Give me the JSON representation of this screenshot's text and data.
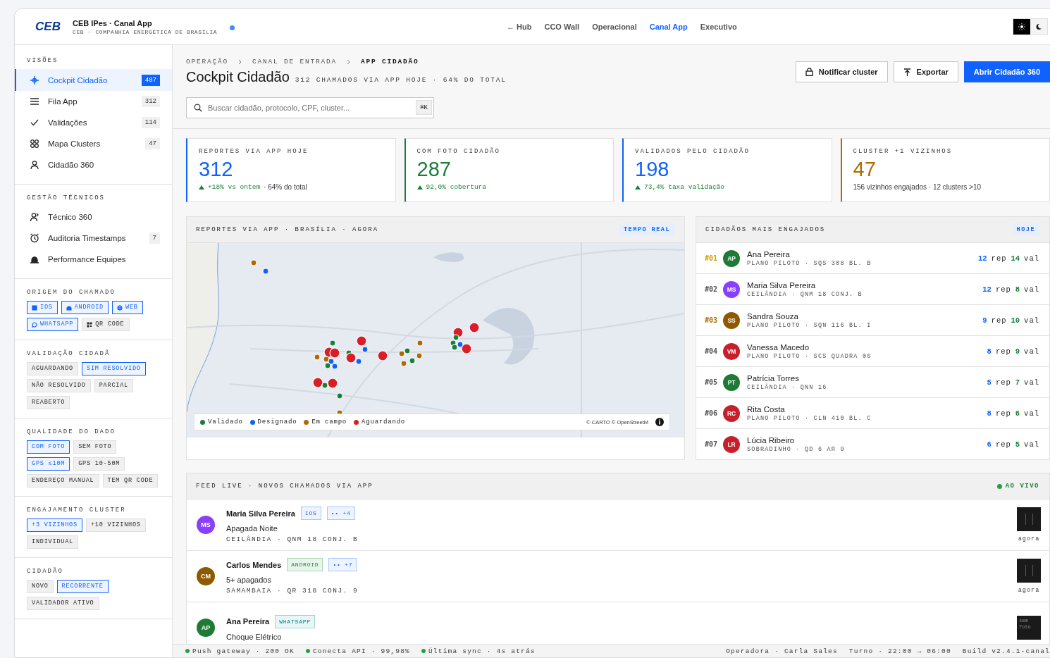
{
  "header": {
    "logo": "CEB",
    "title": "CEB IPes · Canal App",
    "subtitle": "CEB · COMPANHIA ENERGÉTICA DE BRASÍLIA",
    "nav": [
      {
        "label": "← Hub",
        "selected": false
      },
      {
        "label": "CCO Wall",
        "selected": false
      },
      {
        "label": "Operacional",
        "selected": false
      },
      {
        "label": "Canal App",
        "selected": true
      },
      {
        "label": "Executivo",
        "selected": false
      }
    ],
    "theme": [
      {
        "kind": "light",
        "selected": true
      },
      {
        "kind": "dark",
        "selected": false
      }
    ]
  },
  "sidebar": {
    "nav_sections": [
      {
        "title": "VISÕES",
        "items": [
          {
            "label": "Cockpit Cidadão",
            "count": "487",
            "selected": true
          },
          {
            "label": "Fila App",
            "count": "312",
            "selected": false
          },
          {
            "label": "Validações",
            "count": "114",
            "selected": false
          },
          {
            "label": "Mapa Clusters",
            "count": "47",
            "selected": false
          },
          {
            "label": "Cidadão 360",
            "selected": false
          }
        ]
      },
      {
        "title": "GESTÃO TÉCNICOS",
        "items": [
          {
            "label": "Técnico 360",
            "selected": false
          },
          {
            "label": "Auditoria Timestamps",
            "count": "7",
            "selected": false
          },
          {
            "label": "Performance Equipes",
            "selected": false
          }
        ]
      }
    ],
    "filter_groups": [
      {
        "title": "ORIGEM DO CHAMADO",
        "chips": [
          {
            "label": "IOS",
            "selected": true
          },
          {
            "label": "ANDROID",
            "selected": true
          },
          {
            "label": "WEB",
            "selected": true
          },
          {
            "label": "WHATSAPP",
            "selected": true
          },
          {
            "label": "QR CODE",
            "selected": false
          }
        ]
      },
      {
        "title": "VALIDAÇÃO CIDADÃ",
        "chips": [
          {
            "label": "AGUARDANDO",
            "selected": false
          },
          {
            "label": "SIM RESOLVIDO",
            "selected": true
          },
          {
            "label": "NÃO RESOLVIDO",
            "selected": false
          },
          {
            "label": "PARCIAL",
            "selected": false
          },
          {
            "label": "REABERTO",
            "selected": false
          }
        ]
      },
      {
        "title": "QUALIDADE DO DADO",
        "chips": [
          {
            "label": "COM FOTO",
            "selected": true
          },
          {
            "label": "SEM FOTO",
            "selected": false
          },
          {
            "label": "GPS ≤10M",
            "selected": true
          },
          {
            "label": "GPS 10-50M",
            "selected": false
          },
          {
            "label": "ENDEREÇO MANUAL",
            "selected": false
          },
          {
            "label": "TEM QR CODE",
            "selected": false
          }
        ]
      },
      {
        "title": "ENGAJAMENTO CLUSTER",
        "chips": [
          {
            "label": "+3 VIZINHOS",
            "selected": true
          },
          {
            "label": "+10 VIZINHOS",
            "selected": false
          },
          {
            "label": "INDIVIDUAL",
            "selected": false
          }
        ]
      },
      {
        "title": "CIDADÃO",
        "chips": [
          {
            "label": "NOVO",
            "selected": false
          },
          {
            "label": "RECORRENTE",
            "selected": true
          },
          {
            "label": "VALIDADOR ATIVO",
            "selected": false
          }
        ]
      }
    ]
  },
  "breadcrumb": [
    "OPERAÇÃO",
    "CANAL DE ENTRADA",
    "APP CIDADÃO"
  ],
  "page_title": "Cockpit Cidadão",
  "page_subtitle": "312 CHAMADOS VIA APP HOJE · 64% DO TOTAL",
  "actions": [
    {
      "label": "Notificar cluster",
      "kind": "lock"
    },
    {
      "label": "Exportar",
      "kind": "export"
    },
    {
      "label": "Abrir Cidadão 360",
      "kind": "primary"
    }
  ],
  "search": {
    "placeholder": "Buscar cidadão, protocolo, CPF, cluster...",
    "shortcut": "⌘K"
  },
  "kpis": [
    {
      "label": "REPORTES VIA APP HOJE",
      "value": "312",
      "color": "#0f62fe",
      "delta": "+18% vs ontem",
      "note": "· 64% do total"
    },
    {
      "label": "COM FOTO CIDADÃO",
      "value": "287",
      "color": "#198038",
      "delta": "92,0% cobertura"
    },
    {
      "label": "VALIDADOS PELO CIDADÃO",
      "value": "198",
      "color": "#0f62fe",
      "delta": "73,4% taxa validação"
    },
    {
      "label": "CLUSTER +1 VIZINHOS",
      "value": "47",
      "color": "#b06a00",
      "note": "156 vizinhos engajados · 12 clusters >10"
    }
  ],
  "map_panel": {
    "title": "REPORTES VIA APP · BRASÍLIA · AGORA",
    "badge": "TEMPO REAL",
    "legend": [
      {
        "label": "Validado",
        "color": "#198038"
      },
      {
        "label": "Designado",
        "color": "#0f62fe"
      },
      {
        "label": "Em campo",
        "color": "#b06a00"
      },
      {
        "label": "Aguardando",
        "color": "#da1e28"
      }
    ],
    "attribution": "© CARTO © OpenStreetM"
  },
  "ranking": {
    "title": "CIDADÃOS MAIS ENGAJADOS",
    "badge": "HOJE",
    "rows": [
      {
        "rank": {
          "text": "#01",
          "color": "#d2a106"
        },
        "initials": "AP",
        "color": "#1e7a34",
        "name": "Ana Pereira",
        "location": "PLANO PILOTO · SQS 308 BL. B",
        "rep": "12",
        "rep_unit": "rep",
        "val": "14",
        "val_unit": "val"
      },
      {
        "rank": {
          "text": "#02",
          "color": "#525252"
        },
        "initials": "MS",
        "color": "#8a3ffc",
        "name": "Maria Silva Pereira",
        "location": "CEILÂNDIA · QNM 18 CONJ. B",
        "rep": "12",
        "rep_unit": "rep",
        "val": "8",
        "val_unit": "val"
      },
      {
        "rank": {
          "text": "#03",
          "color": "#b06a00"
        },
        "initials": "SS",
        "color": "#8e5a00",
        "name": "Sandra Souza",
        "location": "PLANO PILOTO · SQN 116 BL. I",
        "rep": "9",
        "rep_unit": "rep",
        "val": "10",
        "val_unit": "val"
      },
      {
        "rank": {
          "text": "#04",
          "color": "#525252"
        },
        "initials": "VM",
        "color": "#c8202a",
        "name": "Vanessa Macedo",
        "location": "PLANO PILOTO · SCS QUADRA 06",
        "rep": "8",
        "rep_unit": "rep",
        "val": "9",
        "val_unit": "val"
      },
      {
        "rank": {
          "text": "#05",
          "color": "#525252"
        },
        "initials": "PT",
        "color": "#1e7a34",
        "name": "Patrícia Torres",
        "location": "CEILÂNDIA · QNN 16",
        "rep": "5",
        "rep_unit": "rep",
        "val": "7",
        "val_unit": "val"
      },
      {
        "rank": {
          "text": "#06",
          "color": "#525252"
        },
        "initials": "RC",
        "color": "#c8202a",
        "name": "Rita Costa",
        "location": "PLANO PILOTO · CLN 410 BL. C",
        "rep": "8",
        "rep_unit": "rep",
        "val": "6",
        "val_unit": "val"
      },
      {
        "rank": {
          "text": "#07",
          "color": "#525252"
        },
        "initials": "LR",
        "color": "#c8202a",
        "name": "Lúcia Ribeiro",
        "location": "SOBRADINHO · QD 6 AR 9",
        "rep": "6",
        "rep_unit": "rep",
        "val": "5",
        "val_unit": "val"
      }
    ]
  },
  "feed": {
    "title": "FEED LIVE · NOVOS CHAMADOS VIA APP",
    "live": "AO VIVO",
    "rows": [
      {
        "initials": "MS",
        "color": "#8a3ffc",
        "name": "Maria Silva Pereira",
        "tags": [
          {
            "label": "IOS",
            "kind": "ios"
          },
          {
            "label": "•• +4",
            "kind": "group"
          }
        ],
        "description": "Apagada Noite",
        "location": "CEILÂNDIA · QNM 18 CONJ. B",
        "thumb": {
          "kind": "photo"
        },
        "time": "agora"
      },
      {
        "initials": "CM",
        "color": "#8e5a00",
        "name": "Carlos Mendes",
        "tags": [
          {
            "label": "ANDROID",
            "kind": "android"
          },
          {
            "label": "•• +7",
            "kind": "group"
          }
        ],
        "description": "5+ apagados",
        "location": "SAMAMBAIA · QR 318 CONJ. 9",
        "thumb": {
          "kind": "photo"
        },
        "time": "agora"
      },
      {
        "initials": "AP",
        "color": "#1e7a34",
        "name": "Ana Pereira",
        "tags": [
          {
            "label": "WHATSAPP",
            "kind": "whatsapp"
          }
        ],
        "description": "Choque Elétrico",
        "thumb": {
          "kind": "none",
          "text": "sem foto"
        }
      }
    ]
  },
  "status_bar": {
    "left": [
      "Push gateway · 200 OK",
      "Conecta API · 99,98%",
      "Última sync · 4s atrás"
    ],
    "right": [
      "Operadora · Carla Sales",
      "Turno · 22:00 → 06:00",
      "Build v2.4.1-canal"
    ]
  }
}
